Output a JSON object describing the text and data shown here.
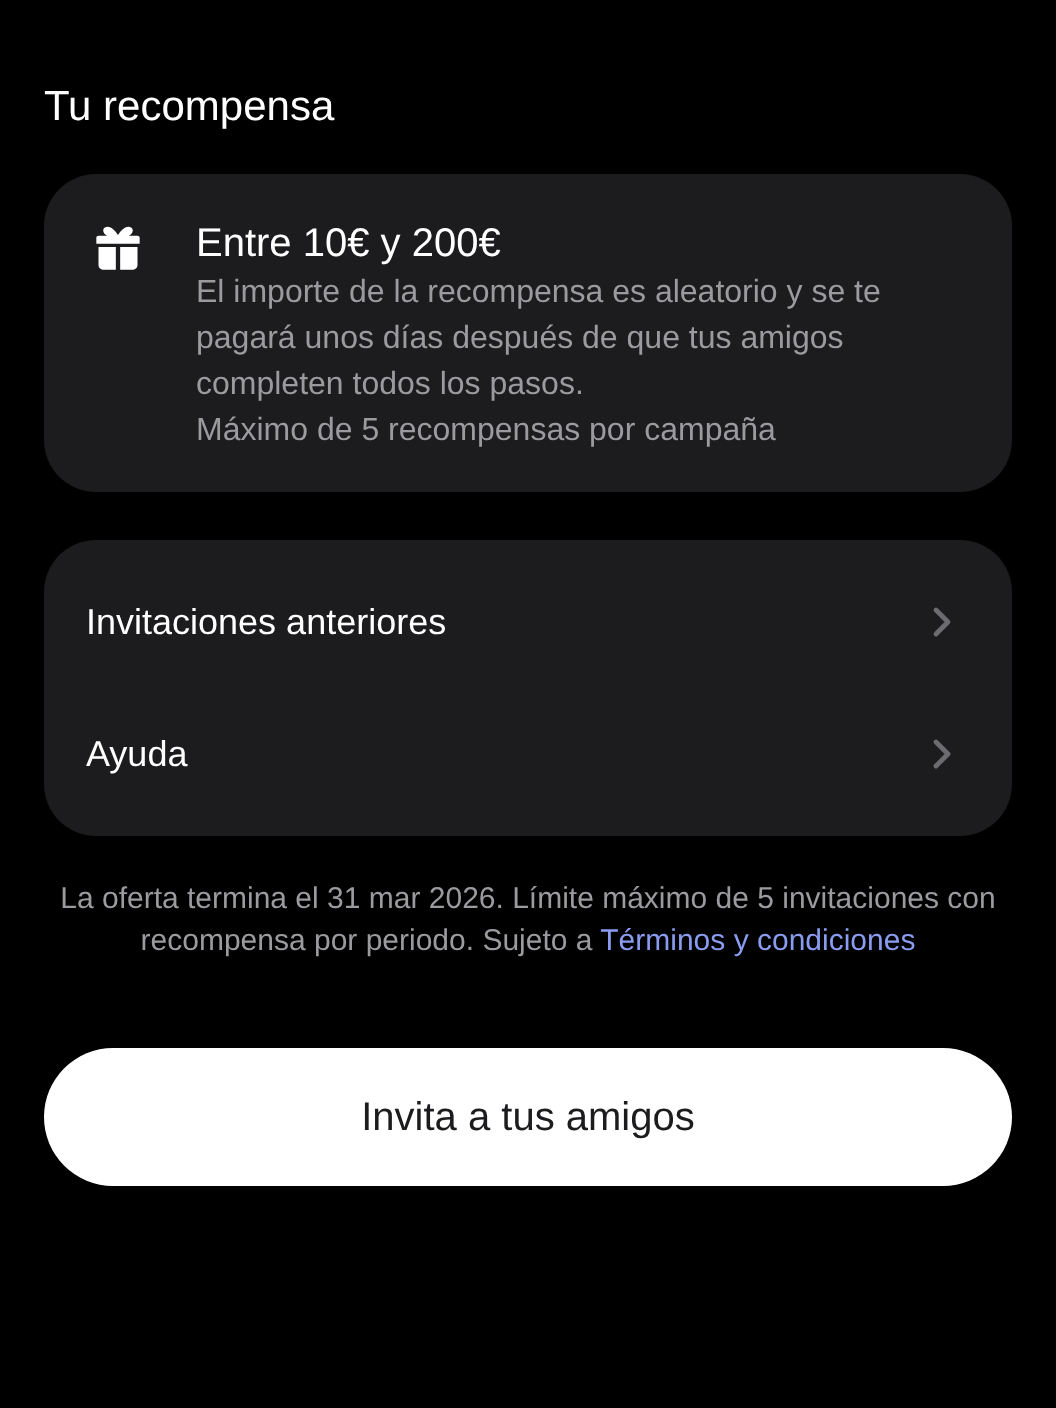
{
  "title": "Tu recompensa",
  "reward": {
    "heading": "Entre 10€ y 200€",
    "description": "El importe de la recompensa es aleatorio y se te pagará unos días después de que tus amigos completen todos los pasos.",
    "limit": "Máximo de 5 recompensas por campaña"
  },
  "menu": [
    {
      "label": "Invitaciones anteriores"
    },
    {
      "label": "Ayuda"
    }
  ],
  "footer": {
    "text": "La oferta termina el 31 mar 2026. Límite máximo de 5 invitaciones con recompensa por periodo. Sujeto a",
    "link": "Términos y condiciones"
  },
  "button": "Invita a tus amigos"
}
